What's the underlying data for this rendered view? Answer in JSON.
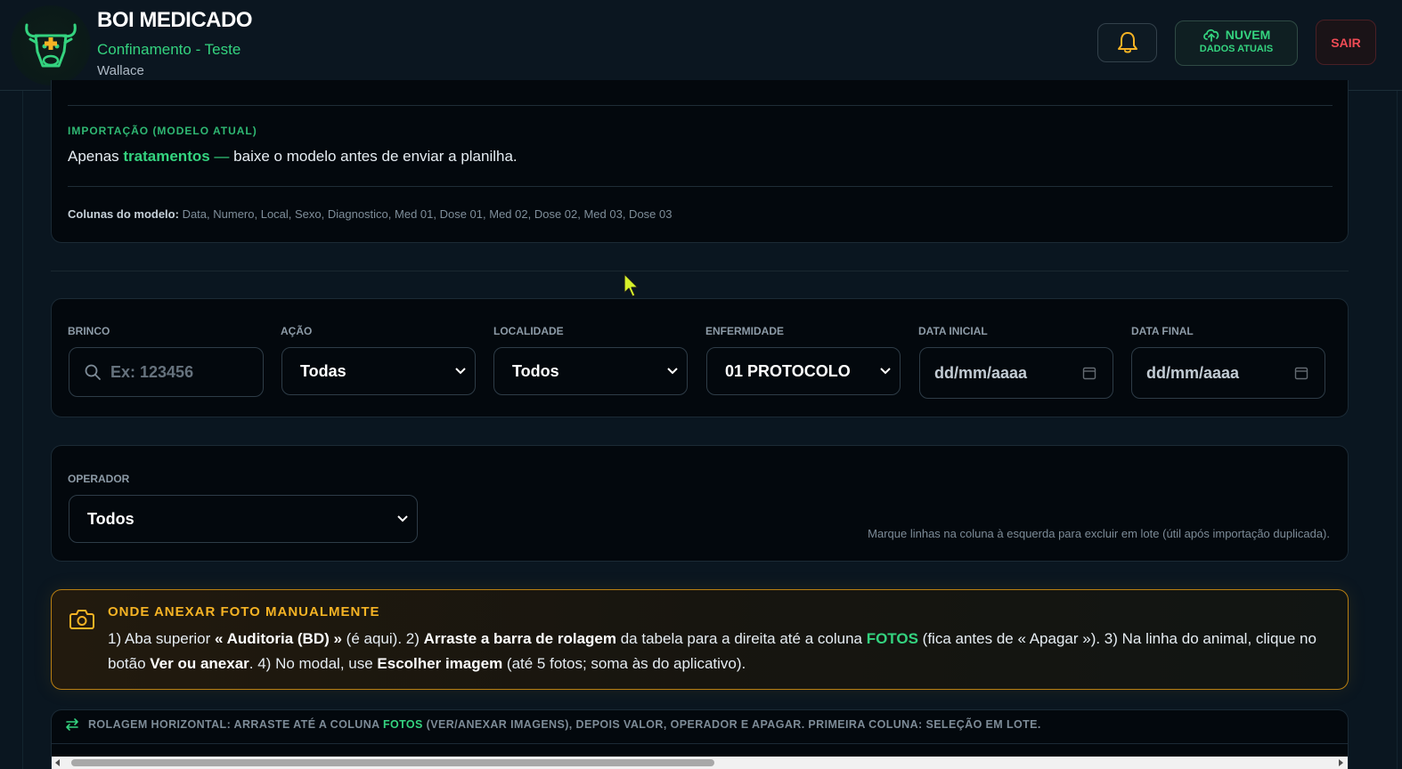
{
  "colors": {
    "accent": "#34d37f",
    "warning": "#f5b324",
    "danger": "#ef4b55",
    "background": "#0a1620",
    "card": "#03080d"
  },
  "header": {
    "title": "BOI MEDICADO",
    "subtitle": "Confinamento - Teste",
    "user": "Wallace",
    "bell_icon": "bell-icon",
    "cloud": {
      "icon": "cloud-upload-icon",
      "top": "NUVEM",
      "bottom": "DADOS ATUAIS"
    },
    "logout_label": "SAIR"
  },
  "import": {
    "label": "IMPORTAÇÃO (MODELO ATUAL)",
    "text_prefix": "Apenas ",
    "text_highlight": "tratamentos",
    "text_dash": " — ",
    "text_suffix": "baixe o modelo antes de enviar a planilha.",
    "columns_label": "Colunas do modelo:",
    "columns_value": " Data, Numero, Local, Sexo, Diagnostico, Med 01, Dose 01, Med 02, Dose 02, Med 03, Dose 03"
  },
  "filters": {
    "brinco": {
      "label": "BRINCO",
      "placeholder": "Ex: 123456",
      "icon": "search-icon"
    },
    "acao": {
      "label": "AÇÃO",
      "value": "Todas"
    },
    "localidade": {
      "label": "LOCALIDADE",
      "value": "Todos"
    },
    "enfermidade": {
      "label": "ENFERMIDADE",
      "value": "01 PROTOCOLO"
    },
    "data_inicial": {
      "label": "DATA INICIAL",
      "value": "dd/mm/aaaa"
    },
    "data_final": {
      "label": "DATA FINAL",
      "value": "dd/mm/aaaa"
    }
  },
  "operador": {
    "label": "OPERADOR",
    "value": "Todos",
    "hint": "Marque linhas na coluna à esquerda para excluir em lote (útil após importação duplicada)."
  },
  "photo_notice": {
    "icon": "camera-icon",
    "title": "ONDE ANEXAR FOTO MANUALMENTE",
    "p1": "1) Aba superior ",
    "b1": "« Auditoria (BD) »",
    "p2": " (é aqui). 2) ",
    "b2": "Arraste a barra de rolagem",
    "p3": " da tabela para a direita até a coluna ",
    "g1": "FOTOS",
    "p4": " (fica antes de « Apagar »). 3) Na linha do animal, clique no botão ",
    "b3": "Ver ou anexar",
    "p5": ". 4) No modal, use ",
    "b4": "Escolher imagem",
    "p6": " (até 5 fotos; soma às do aplicativo)."
  },
  "scroll_hint": {
    "icon": "arrows-horizontal-icon",
    "part1": "ROLAGEM HORIZONTAL: ARRASTE ATÉ A COLUNA ",
    "highlight": "FOTOS",
    "part2": " (VER/ANEXAR IMAGENS), DEPOIS VALOR, OPERADOR E APAGAR. PRIMEIRA COLUNA: SELEÇÃO EM LOTE."
  },
  "table_scroll": {
    "position": 0.0,
    "visible_fraction": 0.5
  }
}
